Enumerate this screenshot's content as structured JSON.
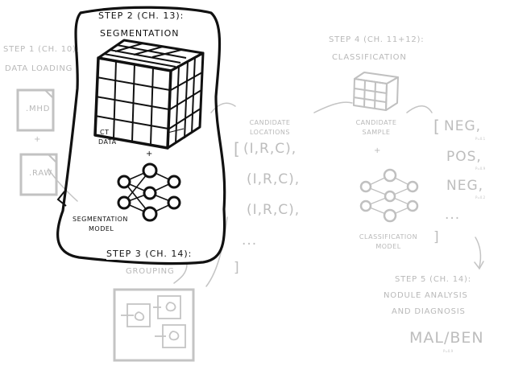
{
  "step1": {
    "title": "STEP 1 (CH. 10):",
    "subtitle": "DATA LOADING",
    "file1": ".MHD",
    "plus": "+",
    "file2": ".RAW"
  },
  "step2": {
    "title": "STEP 2 (CH. 13):",
    "subtitle": "SEGMENTATION",
    "ct_label_1": "CT",
    "ct_label_2": "DATA",
    "plus": "+",
    "model_label_1": "SEGMENTATION",
    "model_label_2": "MODEL"
  },
  "step3": {
    "title": "STEP 3 (CH. 14):",
    "subtitle": "GROUPING"
  },
  "candidates": {
    "label_1": "CANDIDATE",
    "label_2": "LOCATIONS",
    "open_bracket": "[",
    "rows": [
      "(I,R,C),",
      "(I,R,C),",
      "(I,R,C),"
    ],
    "ellipsis": "...",
    "close_bracket": "]"
  },
  "step4": {
    "title": "STEP 4 (CH. 11+12):",
    "subtitle": "CLASSIFICATION",
    "sample_label_1": "CANDIDATE",
    "sample_label_2": "SAMPLE",
    "plus": "+",
    "model_label_1": "CLASSIFICATION",
    "model_label_2": "MODEL"
  },
  "results": {
    "open_bracket": "[",
    "items": [
      "NEG,",
      "POS,",
      "NEG,"
    ],
    "notes": [
      "P=0.1",
      "P=0.9",
      "P=0.2"
    ],
    "ellipsis": "...",
    "close_bracket": "]"
  },
  "step5": {
    "title": "STEP 5 (CH. 14):",
    "subtitle_1": "NODULE ANALYSIS",
    "subtitle_2": "AND DIAGNOSIS",
    "output": "MAL/BEN",
    "note": "P=0.9"
  },
  "colors": {
    "active": "#111111",
    "faded": "#b9b9b9"
  }
}
